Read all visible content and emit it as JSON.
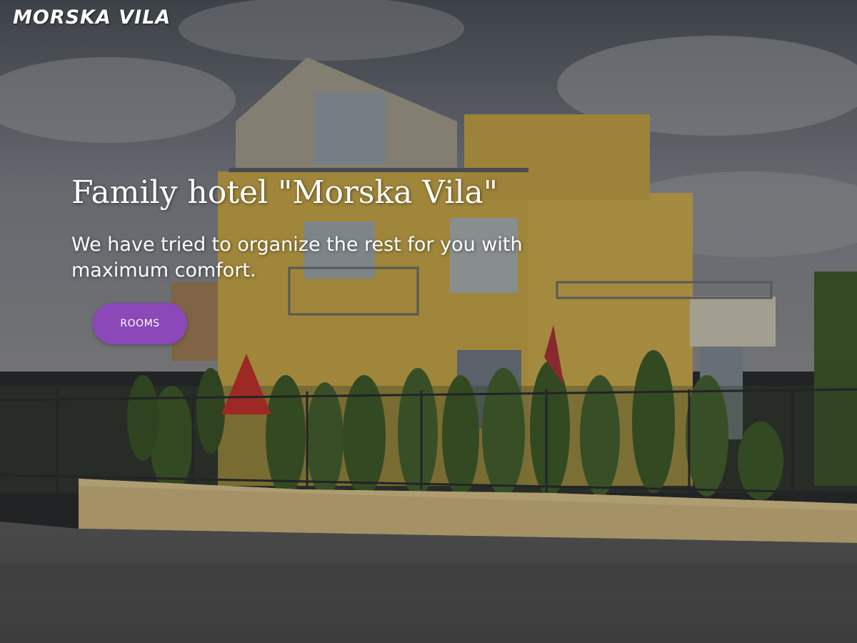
{
  "brand": {
    "name": "MORSKA VILA"
  },
  "hero": {
    "title": "Family hotel \"Morska Vila\"",
    "subtitle": "We have tried to organize the rest for you with maximum comfort.",
    "cta_label": "ROOMS",
    "background_image": "photo-of-yellow-hotel-building-with-fence-and-cypress-trees"
  },
  "colors": {
    "accent": "#8a48b8",
    "text": "#ffffff",
    "building_wall": "#c9a84a",
    "sky": "#6f7379"
  }
}
